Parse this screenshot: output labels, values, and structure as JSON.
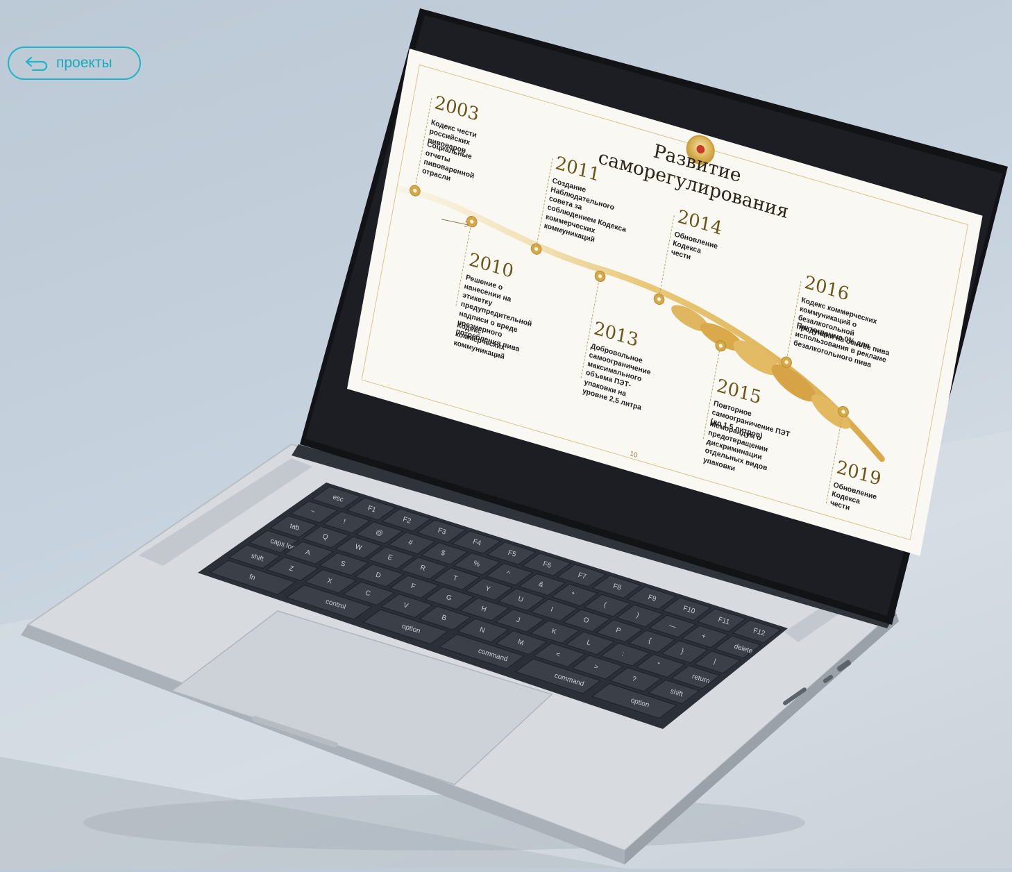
{
  "nav": {
    "back_label": "проекты"
  },
  "slide": {
    "title": "Развитие саморегулирования",
    "page_number": "10",
    "timeline": [
      {
        "year": "2003",
        "lines": [
          "Кодекс чести российских пивоваров",
          "Социальные отчеты пивоваренной отрасли"
        ]
      },
      {
        "year": "2010",
        "lines": [
          "Решение о нанесении на этикетку предупредительной надписи о вреде чрезмерного потребления пива",
          "Кодекс коммерческих коммуникаций"
        ]
      },
      {
        "year": "2011",
        "lines": [
          "Создание Наблюдательного совета за соблюдением Кодекса коммерческих коммуникаций"
        ]
      },
      {
        "year": "2013",
        "lines": [
          "Добровольное самоограничение максимального объема ПЭТ-упаковки на уровне 2,5 литра"
        ]
      },
      {
        "year": "2014",
        "lines": [
          "Обновление Кодекса чести"
        ]
      },
      {
        "year": "2015",
        "lines": [
          "Повторное самоограничение ПЭТ (до 1,5 литров)",
          "Меморандум о предотвращении дискриминации отдельных видов упаковки"
        ]
      },
      {
        "year": "2016",
        "lines": [
          "Кодекс коммерческих коммуникаций о безалкогольной продукции на основе пива",
          "Пиктограмма 0% для использования в рекламе безалкогольного пива"
        ]
      },
      {
        "year": "2019",
        "lines": [
          "Обновление Кодекса чести"
        ]
      }
    ]
  },
  "keyboard": {
    "row_fn": [
      "esc",
      "F1",
      "F2",
      "F3",
      "F4",
      "F5",
      "F6",
      "F7",
      "F8",
      "F9",
      "F10",
      "F11",
      "F12"
    ],
    "row_num": [
      "~",
      "!",
      "@",
      "#",
      "$",
      "%",
      "^",
      "&",
      "*",
      "(",
      ")",
      "—",
      "+",
      "delete"
    ],
    "row_q": [
      "tab",
      "Q",
      "W",
      "E",
      "R",
      "T",
      "Y",
      "U",
      "I",
      "O",
      "P",
      "{",
      "}",
      "|"
    ],
    "row_a": [
      "caps lock",
      "A",
      "S",
      "D",
      "F",
      "G",
      "H",
      "J",
      "K",
      "L",
      ":",
      "\"",
      "return"
    ],
    "row_z": [
      "shift",
      "Z",
      "X",
      "C",
      "V",
      "B",
      "N",
      "M",
      "<",
      ">",
      "?",
      "shift"
    ],
    "row_bottom": [
      "fn",
      "control",
      "option",
      "command",
      "command",
      "option"
    ]
  },
  "colors": {
    "accent": "#20b4c8",
    "gold": "#b68b2c",
    "slide_bg": "#faf8f2"
  }
}
